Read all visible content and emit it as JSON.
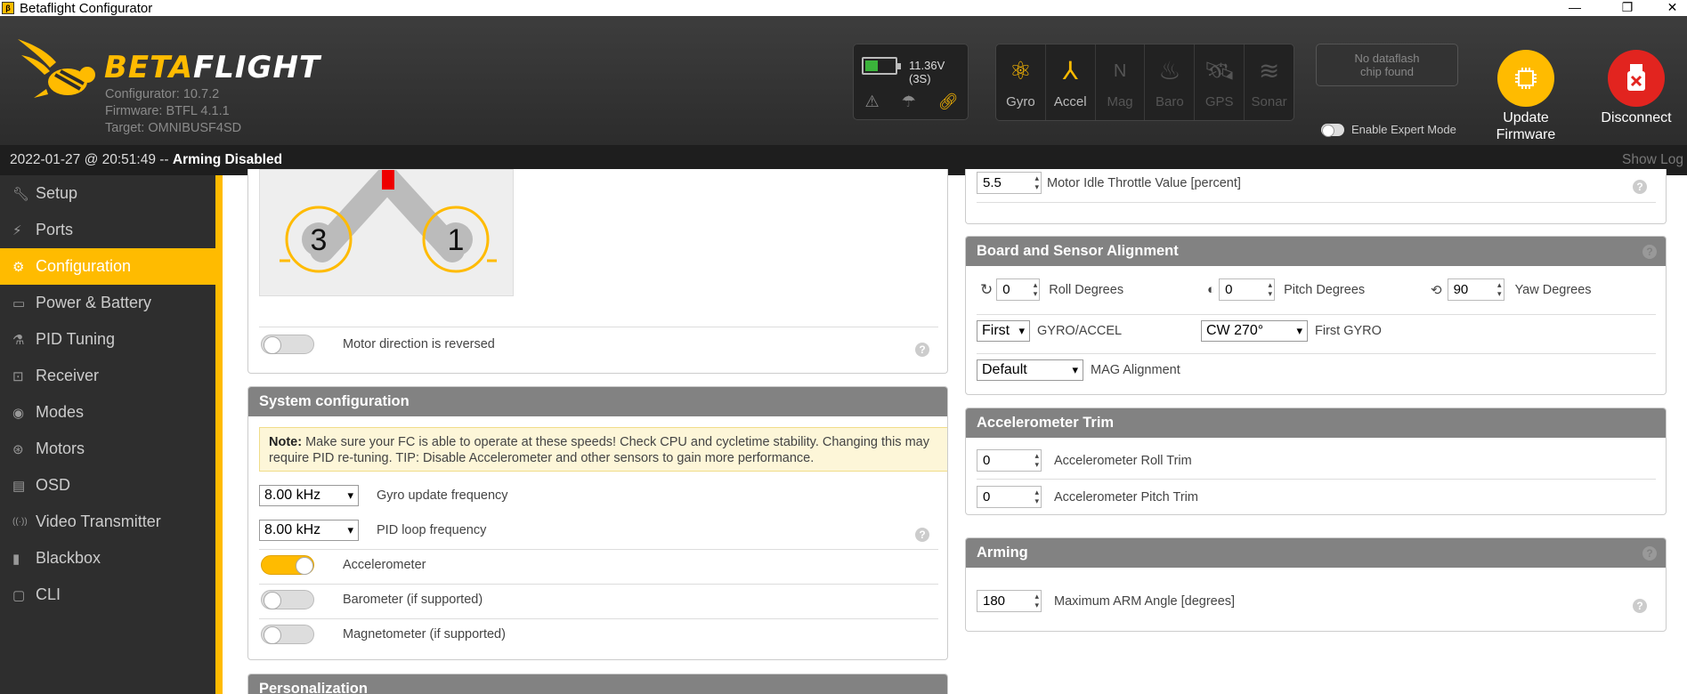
{
  "window": {
    "title": "Betaflight Configurator",
    "minimize": "—",
    "maximize": "❐",
    "close": "✕"
  },
  "header": {
    "brand_part1": "BETA",
    "brand_part2": "FLIGHT",
    "configurator_version": "Configurator: 10.7.2",
    "firmware": "Firmware: BTFL 4.1.1",
    "target": "Target: OMNIBUSF4SD",
    "battery_voltage": "11.36V (3S)",
    "battery_level": 0.4,
    "sensors": [
      {
        "label": "Gyro",
        "icon": "gyro-icon",
        "active": true
      },
      {
        "label": "Accel",
        "icon": "accel-icon",
        "active": true
      },
      {
        "label": "Mag",
        "icon": "mag-icon",
        "active": false
      },
      {
        "label": "Baro",
        "icon": "baro-icon",
        "active": false
      },
      {
        "label": "GPS",
        "icon": "gps-icon",
        "active": false
      },
      {
        "label": "Sonar",
        "icon": "sonar-icon",
        "active": false
      }
    ],
    "dataflash_line1": "No dataflash",
    "dataflash_line2": "chip found",
    "expert_mode_label": "Enable Expert Mode",
    "update_firmware_line1": "Update",
    "update_firmware_line2": "Firmware",
    "disconnect_label": "Disconnect",
    "colors": {
      "accent": "#ffbb00",
      "disconnect": "#e2241f"
    }
  },
  "statusbar": {
    "timestamp": "2022-01-27 @ 20:51:49 -- ",
    "arming_state": "Arming Disabled",
    "show_log": "Show Log"
  },
  "sidebar": {
    "items": [
      {
        "label": "Setup",
        "icon": "wrench-icon"
      },
      {
        "label": "Ports",
        "icon": "plug-icon"
      },
      {
        "label": "Configuration",
        "icon": "gear-icon",
        "active": true
      },
      {
        "label": "Power & Battery",
        "icon": "battery-icon"
      },
      {
        "label": "PID Tuning",
        "icon": "pid-icon"
      },
      {
        "label": "Receiver",
        "icon": "receiver-icon"
      },
      {
        "label": "Modes",
        "icon": "modes-icon"
      },
      {
        "label": "Motors",
        "icon": "motors-icon"
      },
      {
        "label": "OSD",
        "icon": "osd-icon"
      },
      {
        "label": "Video Transmitter",
        "icon": "vtx-icon"
      },
      {
        "label": "Blackbox",
        "icon": "blackbox-icon"
      },
      {
        "label": "CLI",
        "icon": "cli-icon"
      }
    ]
  },
  "mixer": {
    "motor3": "3",
    "motor1": "1",
    "motor_direction_label": "Motor direction is reversed",
    "motor_direction_reversed": false
  },
  "system_config": {
    "title": "System configuration",
    "note_bold": "Note:",
    "note_text": " Make sure your FC is able to operate at these speeds! Check CPU and cycletime stability. Changing this may require PID re-tuning. TIP: Disable Accelerometer and other sensors to gain more performance.",
    "gyro_freq_value": "8.00 kHz",
    "gyro_freq_label": "Gyro update frequency",
    "pid_freq_value": "8.00 kHz",
    "pid_freq_label": "PID loop frequency",
    "accelerometer_label": "Accelerometer",
    "accelerometer_on": true,
    "barometer_label": "Barometer (if supported)",
    "barometer_on": false,
    "magnetometer_label": "Magnetometer (if supported)",
    "magnetometer_on": false
  },
  "personalization": {
    "title": "Personalization"
  },
  "motor_idle": {
    "value": "5.5",
    "label": "Motor Idle Throttle Value [percent]"
  },
  "alignment": {
    "title": "Board and Sensor Alignment",
    "roll_value": "0",
    "roll_label": "Roll Degrees",
    "pitch_value": "0",
    "pitch_label": "Pitch Degrees",
    "yaw_value": "90",
    "yaw_label": "Yaw Degrees",
    "gyro_select": "First",
    "gyro_select_label": "GYRO/ACCEL",
    "gyro_align": "CW 270°",
    "gyro_align_label": "First GYRO",
    "mag_align": "Default",
    "mag_align_label": "MAG Alignment"
  },
  "acc_trim": {
    "title": "Accelerometer Trim",
    "roll_value": "0",
    "roll_label": "Accelerometer Roll Trim",
    "pitch_value": "0",
    "pitch_label": "Accelerometer Pitch Trim"
  },
  "arming": {
    "title": "Arming",
    "angle_value": "180",
    "angle_label": "Maximum ARM Angle [degrees]"
  },
  "help_glyph": "?"
}
